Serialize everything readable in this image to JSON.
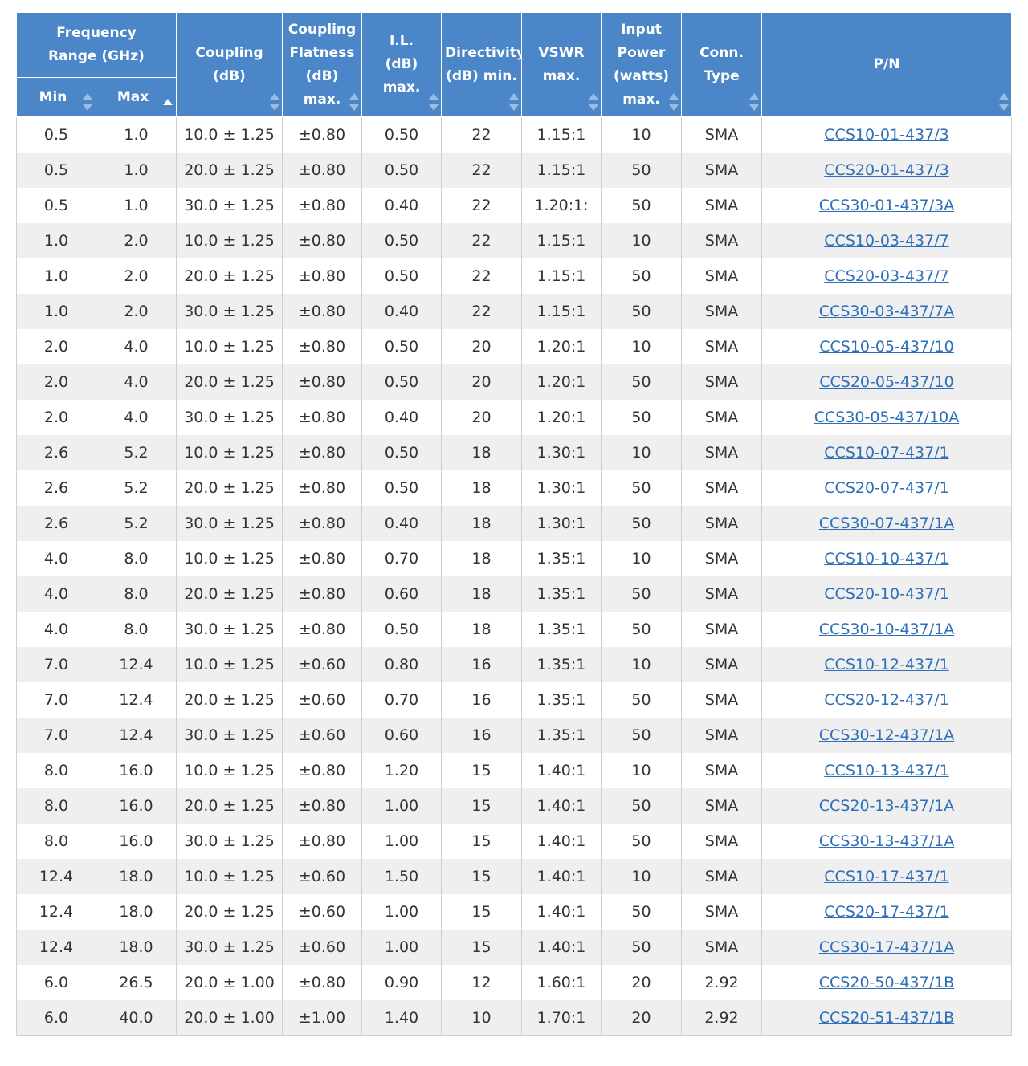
{
  "headers": {
    "freq_range": "Frequency Range (GHz)",
    "min": "Min",
    "max": "Max",
    "coupling_l1": "Coupling",
    "coupling_l2": "(dB)",
    "flat_l1": "Coupling",
    "flat_l2": "Flatness",
    "flat_l3": "(dB)",
    "flat_l4": "max.",
    "il_l1": "I.L.",
    "il_l2": "(dB)",
    "il_l3": "max.",
    "dir_l1": "Directivity",
    "dir_l2": "(dB) min.",
    "vswr_l1": "VSWR",
    "vswr_l2": "max.",
    "pow_l1": "Input",
    "pow_l2": "Power",
    "pow_l3": "(watts)",
    "pow_l4": "max.",
    "conn_l1": "Conn.",
    "conn_l2": "Type",
    "pn": "P/N"
  },
  "rows": [
    [
      "0.5",
      "1.0",
      "10.0 ± 1.25",
      "±0.80",
      "0.50",
      "22",
      "1.15:1",
      "10",
      "SMA",
      "CCS10-01-437/3"
    ],
    [
      "0.5",
      "1.0",
      "20.0 ± 1.25",
      "±0.80",
      "0.50",
      "22",
      "1.15:1",
      "50",
      "SMA",
      "CCS20-01-437/3"
    ],
    [
      "0.5",
      "1.0",
      "30.0 ± 1.25",
      "±0.80",
      "0.40",
      "22",
      "1.20:1:",
      "50",
      "SMA",
      "CCS30-01-437/3A"
    ],
    [
      "1.0",
      "2.0",
      "10.0 ± 1.25",
      "±0.80",
      "0.50",
      "22",
      "1.15:1",
      "10",
      "SMA",
      "CCS10-03-437/7"
    ],
    [
      "1.0",
      "2.0",
      "20.0 ± 1.25",
      "±0.80",
      "0.50",
      "22",
      "1.15:1",
      "50",
      "SMA",
      "CCS20-03-437/7"
    ],
    [
      "1.0",
      "2.0",
      "30.0 ± 1.25",
      "±0.80",
      "0.40",
      "22",
      "1.15:1",
      "50",
      "SMA",
      "CCS30-03-437/7A"
    ],
    [
      "2.0",
      "4.0",
      "10.0 ± 1.25",
      "±0.80",
      "0.50",
      "20",
      "1.20:1",
      "10",
      "SMA",
      "CCS10-05-437/10"
    ],
    [
      "2.0",
      "4.0",
      "20.0 ± 1.25",
      "±0.80",
      "0.50",
      "20",
      "1.20:1",
      "50",
      "SMA",
      "CCS20-05-437/10"
    ],
    [
      "2.0",
      "4.0",
      "30.0 ± 1.25",
      "±0.80",
      "0.40",
      "20",
      "1.20:1",
      "50",
      "SMA",
      "CCS30-05-437/10A"
    ],
    [
      "2.6",
      "5.2",
      "10.0 ± 1.25",
      "±0.80",
      "0.50",
      "18",
      "1.30:1",
      "10",
      "SMA",
      "CCS10-07-437/1"
    ],
    [
      "2.6",
      "5.2",
      "20.0 ± 1.25",
      "±0.80",
      "0.50",
      "18",
      "1.30:1",
      "50",
      "SMA",
      "CCS20-07-437/1"
    ],
    [
      "2.6",
      "5.2",
      "30.0 ± 1.25",
      "±0.80",
      "0.40",
      "18",
      "1.30:1",
      "50",
      "SMA",
      "CCS30-07-437/1A"
    ],
    [
      "4.0",
      "8.0",
      "10.0 ± 1.25",
      "±0.80",
      "0.70",
      "18",
      "1.35:1",
      "10",
      "SMA",
      "CCS10-10-437/1"
    ],
    [
      "4.0",
      "8.0",
      "20.0 ± 1.25",
      "±0.80",
      "0.60",
      "18",
      "1.35:1",
      "50",
      "SMA",
      "CCS20-10-437/1"
    ],
    [
      "4.0",
      "8.0",
      "30.0 ± 1.25",
      "±0.80",
      "0.50",
      "18",
      "1.35:1",
      "50",
      "SMA",
      "CCS30-10-437/1A"
    ],
    [
      "7.0",
      "12.4",
      "10.0 ± 1.25",
      "±0.60",
      "0.80",
      "16",
      "1.35:1",
      "10",
      "SMA",
      "CCS10-12-437/1"
    ],
    [
      "7.0",
      "12.4",
      "20.0 ± 1.25",
      "±0.60",
      "0.70",
      "16",
      "1.35:1",
      "50",
      "SMA",
      "CCS20-12-437/1"
    ],
    [
      "7.0",
      "12.4",
      "30.0 ± 1.25",
      "±0.60",
      "0.60",
      "16",
      "1.35:1",
      "50",
      "SMA",
      "CCS30-12-437/1A"
    ],
    [
      "8.0",
      "16.0",
      "10.0 ± 1.25",
      "±0.80",
      "1.20",
      "15",
      "1.40:1",
      "10",
      "SMA",
      "CCS10-13-437/1"
    ],
    [
      "8.0",
      "16.0",
      "20.0 ± 1.25",
      "±0.80",
      "1.00",
      "15",
      "1.40:1",
      "50",
      "SMA",
      "CCS20-13-437/1A"
    ],
    [
      "8.0",
      "16.0",
      "30.0 ± 1.25",
      "±0.80",
      "1.00",
      "15",
      "1.40:1",
      "50",
      "SMA",
      "CCS30-13-437/1A"
    ],
    [
      "12.4",
      "18.0",
      "10.0 ± 1.25",
      "±0.60",
      "1.50",
      "15",
      "1.40:1",
      "10",
      "SMA",
      "CCS10-17-437/1"
    ],
    [
      "12.4",
      "18.0",
      "20.0 ± 1.25",
      "±0.60",
      "1.00",
      "15",
      "1.40:1",
      "50",
      "SMA",
      "CCS20-17-437/1"
    ],
    [
      "12.4",
      "18.0",
      "30.0 ± 1.25",
      "±0.60",
      "1.00",
      "15",
      "1.40:1",
      "50",
      "SMA",
      "CCS30-17-437/1A"
    ],
    [
      "6.0",
      "26.5",
      "20.0 ± 1.00",
      "±0.80",
      "0.90",
      "12",
      "1.60:1",
      "20",
      "2.92",
      "CCS20-50-437/1B"
    ],
    [
      "6.0",
      "40.0",
      "20.0 ± 1.00",
      "±1.00",
      "1.40",
      "10",
      "1.70:1",
      "20",
      "2.92",
      "CCS20-51-437/1B"
    ]
  ],
  "colors": {
    "header_bg": "#4a86c8",
    "link": "#2e6fb8",
    "row_alt": "#efefef"
  }
}
